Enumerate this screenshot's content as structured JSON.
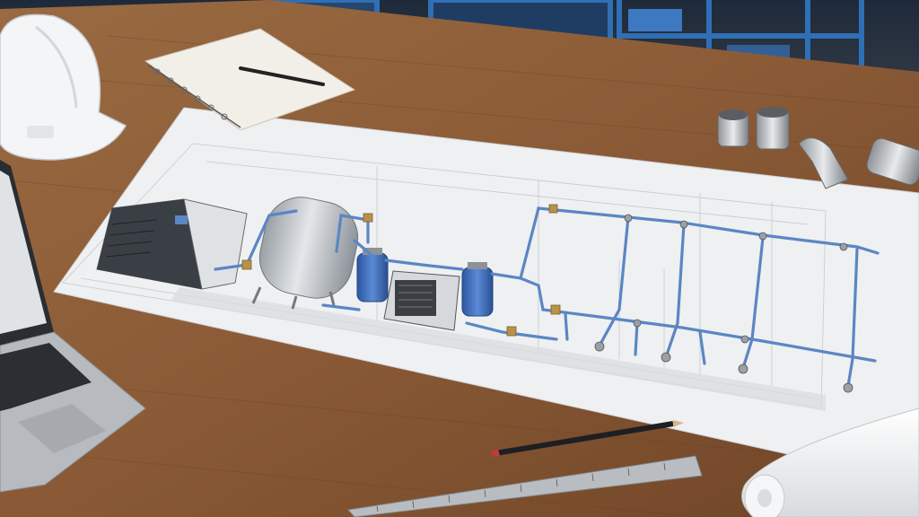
{
  "scene": {
    "colors": {
      "desk": "#8a5a36",
      "desk_dark": "#5e3a20",
      "paper": "#eef0f2",
      "pipe": "#5b86c4",
      "filter_blue": "#3f6fc0",
      "machine": "#c9cdd1",
      "shelf_blue": "#2f6fb5"
    },
    "objects": [
      {
        "name": "hard-hat",
        "icon": "hard-hat-icon"
      },
      {
        "name": "spiral-notebook",
        "icon": "notebook-icon"
      },
      {
        "name": "pen",
        "icon": "pen-icon"
      },
      {
        "name": "laptop",
        "icon": "laptop-icon"
      },
      {
        "name": "blueprint",
        "icon": "compressed-air-piping-diagram"
      },
      {
        "name": "pipe-fittings",
        "icon": "fitting-icon"
      },
      {
        "name": "pencil",
        "icon": "pencil-icon"
      },
      {
        "name": "steel-ruler",
        "icon": "ruler-icon"
      },
      {
        "name": "rolled-drawing",
        "icon": "paper-roll-icon"
      }
    ]
  }
}
